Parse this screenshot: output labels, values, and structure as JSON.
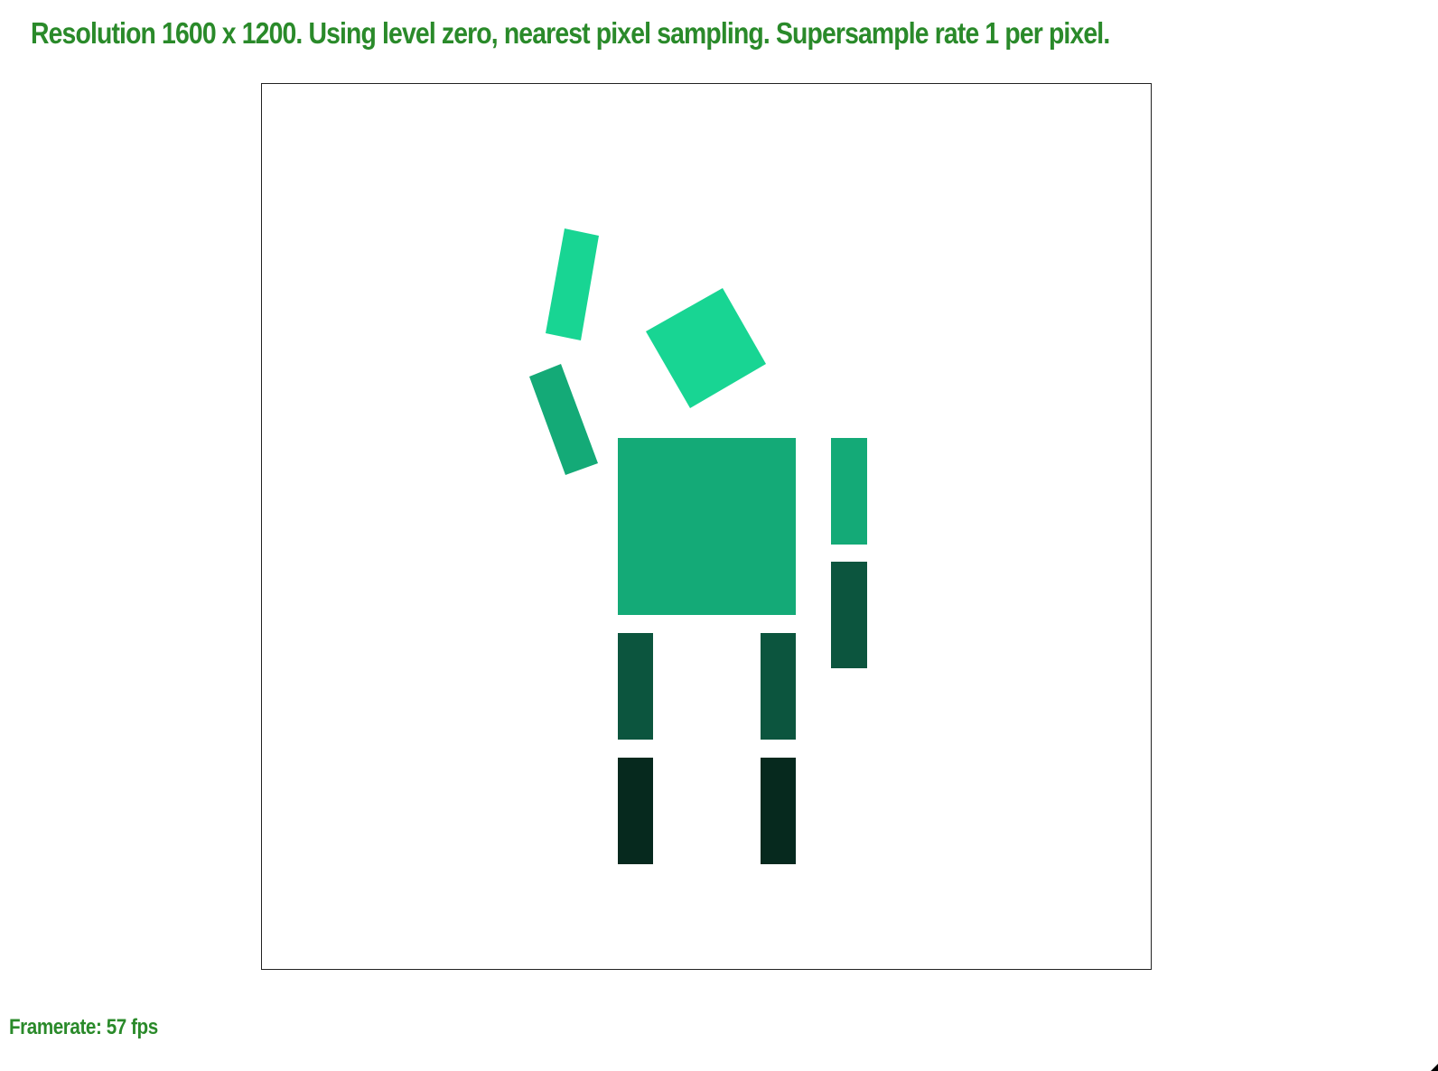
{
  "header": {
    "status_text": "Resolution 1600 x 1200. Using level zero, nearest pixel sampling. Supersample rate 1 per pixel."
  },
  "footer": {
    "framerate_text": "Framerate: 57 fps"
  },
  "colors": {
    "status_text": "#2a8a2a",
    "viewport_border": "#222222",
    "light_green": "#18d593",
    "mid_green": "#14aa77",
    "dark_green": "#0c553e",
    "darkest_green": "#06291e"
  },
  "scene": {
    "figure": "stick-figure-robot",
    "parts": [
      {
        "name": "head-block",
        "color": "light_green"
      },
      {
        "name": "raised-forearm-block",
        "color": "light_green"
      },
      {
        "name": "raised-upper-arm-block",
        "color": "mid_green"
      },
      {
        "name": "torso-block",
        "color": "mid_green"
      },
      {
        "name": "right-upper-arm-block",
        "color": "mid_green"
      },
      {
        "name": "right-forearm-block",
        "color": "dark_green"
      },
      {
        "name": "left-thigh-block",
        "color": "dark_green"
      },
      {
        "name": "right-thigh-block",
        "color": "dark_green"
      },
      {
        "name": "left-shin-block",
        "color": "darkest_green"
      },
      {
        "name": "right-shin-block",
        "color": "darkest_green"
      }
    ]
  }
}
